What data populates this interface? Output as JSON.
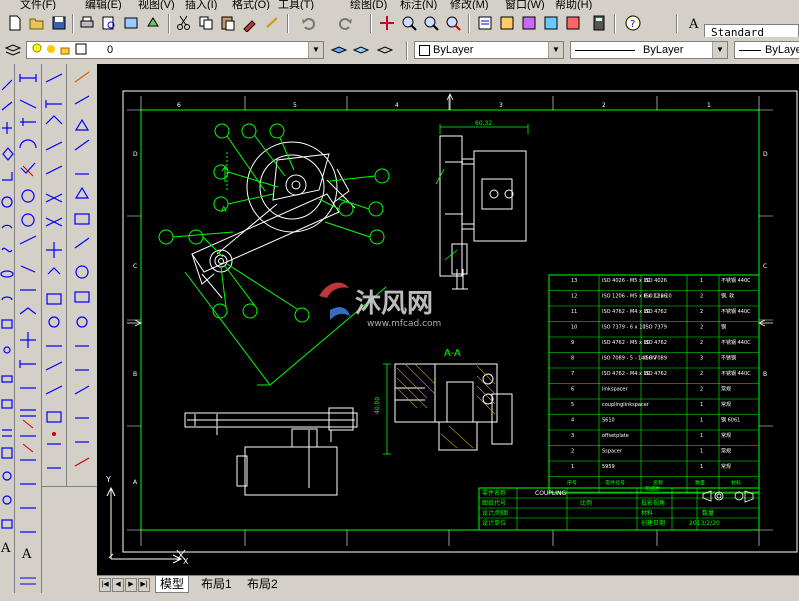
{
  "menubar": {
    "items": [
      "文件(F)",
      "编辑(E)",
      "视图(V)",
      "插入(I)",
      "格式(O)",
      "工具(T)",
      "绘图(D)",
      "标注(N)",
      "修改(M)",
      "窗口(W)",
      "帮助(H)"
    ]
  },
  "toolbar": {
    "text_style": "Standard",
    "layer_name": "0",
    "color": "ByLayer",
    "linetype": "ByLayer",
    "lineweight": "ByLayer"
  },
  "tabs": {
    "model": "模型",
    "layout1": "布局1",
    "layout2": "布局2"
  },
  "drawing": {
    "section_label": "A-A",
    "view_label_a": "A",
    "top_dim": "60.32",
    "side_dim": "40.00",
    "watermark_main": "沐风网",
    "watermark_url": "www.mfcad.com",
    "border_numbers_top": [
      "6",
      "5",
      "4",
      "3",
      "2",
      "1"
    ],
    "border_letters": [
      "D",
      "C",
      "B",
      "A"
    ],
    "ucs_x": "X",
    "ucs_y": "Y"
  },
  "bom": {
    "rows": [
      {
        "no": "13",
        "code": "ISO 4026 - M5 x 10",
        "std": "ISO 4026",
        "qty": "1",
        "mat": "不锈钢 440C"
      },
      {
        "no": "12",
        "code": "ISO 1206 - M5 x 8 x 12 x 10",
        "std": "ISO 1206",
        "qty": "2",
        "mat": "钢, 软"
      },
      {
        "no": "11",
        "code": "ISO 4762 - M4 x 10",
        "std": "ISO 4762",
        "qty": "2",
        "mat": "不锈钢 440C"
      },
      {
        "no": "10",
        "code": "ISO 7379 - 6 x 10",
        "std": "ISO 7379",
        "qty": "2",
        "mat": "钢"
      },
      {
        "no": "9",
        "code": "ISO 4762 - M5 x 10",
        "std": "ISO 4762",
        "qty": "2",
        "mat": "不锈钢 440C"
      },
      {
        "no": "8",
        "code": "ISO 7089 - 5 - 140 HV",
        "std": "ISO 7089",
        "qty": "3",
        "mat": "不锈钢"
      },
      {
        "no": "7",
        "code": "ISO 4762 - M4 x 10",
        "std": "ISO 4762",
        "qty": "2",
        "mat": "不锈钢 440C"
      },
      {
        "no": "6",
        "code": "linkspacer",
        "std": "",
        "qty": "2",
        "mat": "常规"
      },
      {
        "no": "5",
        "code": "couplinglinkspacer",
        "std": "",
        "qty": "1",
        "mat": "常规"
      },
      {
        "no": "4",
        "code": "S610",
        "std": "",
        "qty": "1",
        "mat": "钢 6061"
      },
      {
        "no": "3",
        "code": "offsetplate",
        "std": "",
        "qty": "1",
        "mat": "常规"
      },
      {
        "no": "2",
        "code": "Sspacer",
        "std": "",
        "qty": "1",
        "mat": "常规"
      },
      {
        "no": "1",
        "code": "5959",
        "std": "",
        "qty": "1",
        "mat": "常规"
      }
    ],
    "header": {
      "no": "序号",
      "code": "零件代号",
      "name": "名称",
      "qty": "数量",
      "mat": "材料"
    },
    "footer": "明细栏"
  },
  "titleblock": {
    "part_label": "零件名称",
    "part_name": "COUPLING",
    "drawing_no": "图纸代号",
    "scale_label": "比例",
    "projection": "投影视角",
    "designer": "设计/制图",
    "material": "材料",
    "quantity": "数量",
    "unit": "设计单位",
    "date_label": "创建日期",
    "date": "2013/2/20"
  },
  "colors": {
    "bg": "#000000",
    "lines": "#ffffff",
    "green": "#00ff00",
    "border": "#00ff00"
  }
}
